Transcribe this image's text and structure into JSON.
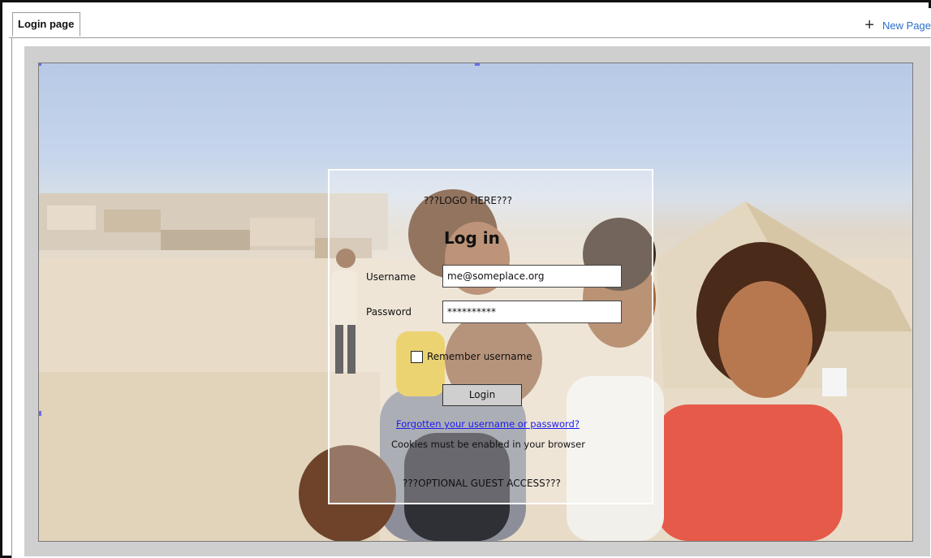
{
  "tabs": {
    "active_label": "Login page",
    "new_page_label": "New Page"
  },
  "login": {
    "logo_placeholder": "???LOGO HERE???",
    "heading": "Log in",
    "username_label": "Username",
    "username_value": "me@someplace.org",
    "password_label": "Password",
    "password_value": "**********",
    "remember_label": "Remember username",
    "login_button": "Login",
    "forgot_link": "Forgotten your username or password?",
    "cookies_note": "Cookies must be enabled in your browser",
    "guest_access": "???OPTIONAL GUEST ACCESS???"
  },
  "colors": {
    "link": "#1a1aee",
    "accent": "#2a6fc9",
    "selection_handle": "#6b6be6"
  },
  "icons": {
    "new_page": "plus-icon"
  }
}
